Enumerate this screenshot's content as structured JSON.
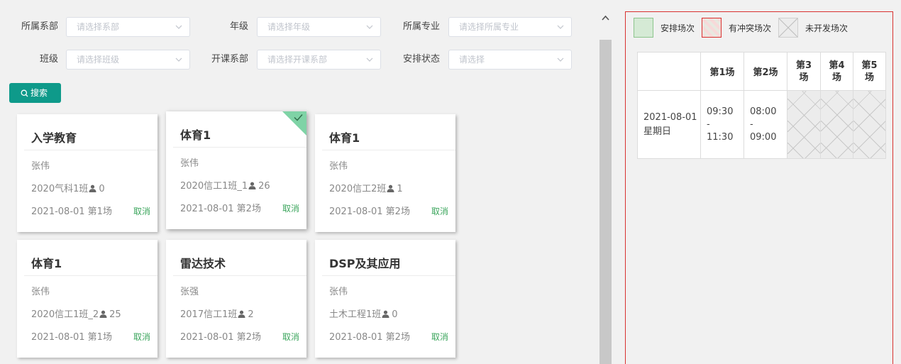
{
  "filters": [
    {
      "label": "所属系部",
      "placeholder": "请选择系部"
    },
    {
      "label": "年级",
      "placeholder": "请选择年级"
    },
    {
      "label": "所属专业",
      "placeholder": "请选择所属专业"
    },
    {
      "label": "班级",
      "placeholder": "请选择班级"
    },
    {
      "label": "开课系部",
      "placeholder": "请选择开课系部"
    },
    {
      "label": "安排状态",
      "placeholder": "请选择"
    }
  ],
  "search_button": {
    "label": "搜索"
  },
  "cards": [
    {
      "title": "入学教育",
      "teacher": "张伟",
      "class": "2020气科1班",
      "count": "0",
      "date_session": "2021-08-01 第1场",
      "cancel": "取消"
    },
    {
      "title": "体育1",
      "teacher": "张伟",
      "class": "2020信工1班_1",
      "count": "26",
      "date_session": "2021-08-01 第2场",
      "cancel": "取消"
    },
    {
      "title": "体育1",
      "teacher": "张伟",
      "class": "2020信工2班",
      "count": "1",
      "date_session": "2021-08-01 第2场",
      "cancel": "取消"
    },
    {
      "title": "体育1",
      "teacher": "张伟",
      "class": "2020信工1班_2",
      "count": "25",
      "date_session": "2021-08-01 第1场",
      "cancel": "取消"
    },
    {
      "title": "雷达技术",
      "teacher": "张强",
      "class": "2017信工1班",
      "count": "2",
      "date_session": "2021-08-01 第2场",
      "cancel": "取消"
    },
    {
      "title": "DSP及其应用",
      "teacher": "张伟",
      "class": "土木工程1班",
      "count": "0",
      "date_session": "2021-08-01 第2场",
      "cancel": "取消"
    }
  ],
  "legend": {
    "arranged": "安排场次",
    "conflict": "有冲突场次",
    "not_open": "未开发场次"
  },
  "colors": {
    "accent": "#0e9a8a",
    "cancel_green": "#3ba55c",
    "selected_corner": "#7fd3a6",
    "arranged_fill": "#d5ead5",
    "conflict_border": "#d9312f"
  },
  "schedule": {
    "headers": [
      "",
      "第1场",
      "第2场",
      "第3场",
      "第4场",
      "第5场"
    ],
    "rows": [
      {
        "date": "2021-08-01",
        "weekday": "星期日",
        "session1": {
          "start": "09:30",
          "sep": "-",
          "end": "11:30"
        },
        "session2": {
          "start": "08:00",
          "sep": "-",
          "end": "09:00"
        }
      }
    ]
  }
}
